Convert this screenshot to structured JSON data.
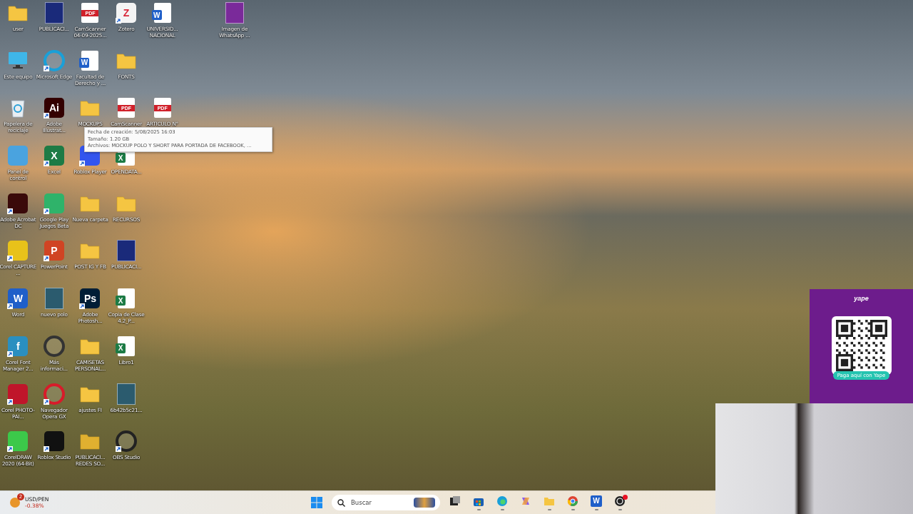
{
  "desktop": {
    "columns": [
      [
        {
          "label": "user",
          "kind": "folder",
          "color": "#f5c542",
          "shortcut": false
        },
        {
          "label": "Este equipo",
          "kind": "pc",
          "color": "#3fb6e8",
          "shortcut": false
        },
        {
          "label": "Papelera de reciclaje",
          "kind": "recycle",
          "color": "#e9eef2",
          "shortcut": false
        },
        {
          "label": "Panel de control",
          "kind": "tile",
          "color": "#4aa3df",
          "shortcut": false
        },
        {
          "label": "Adobe Acrobat DC",
          "kind": "tile",
          "color": "#3a0a0a",
          "shortcut": true
        },
        {
          "label": "Corel CAPTURE ...",
          "kind": "tile",
          "color": "#e8c21a",
          "shortcut": true
        },
        {
          "label": "Word",
          "kind": "tile",
          "color": "#1f5fc9",
          "glyph": "W",
          "shortcut": true
        },
        {
          "label": "Corel Font Manager 2...",
          "kind": "tile",
          "color": "#2a8fc0",
          "glyph": "f",
          "shortcut": true
        },
        {
          "label": "Corel PHOTO-PAI...",
          "kind": "tile",
          "color": "#c0152a",
          "shortcut": true
        },
        {
          "label": "CorelDRAW 2020 (64-Bit)",
          "kind": "tile",
          "color": "#3cc84a",
          "shortcut": true
        }
      ],
      [
        {
          "label": "PUBLICACI...",
          "kind": "image",
          "color": "#1a2a7a",
          "shortcut": false
        },
        {
          "label": "Microsoft Edge",
          "kind": "circle",
          "color": "#1aa0d8",
          "shortcut": true
        },
        {
          "label": "Adobe Illustrat...",
          "kind": "tile",
          "color": "#330000",
          "glyph": "Ai",
          "shortcut": true
        },
        {
          "label": "Excel",
          "kind": "tile",
          "color": "#1d7b45",
          "glyph": "X",
          "shortcut": true
        },
        {
          "label": "Google Play Juegos Beta",
          "kind": "tile",
          "color": "#2fb36a",
          "shortcut": true
        },
        {
          "label": "PowerPoint",
          "kind": "tile",
          "color": "#d04423",
          "glyph": "P",
          "shortcut": true
        },
        {
          "label": "nuevo polo",
          "kind": "image",
          "color": "#2b5b6e",
          "shortcut": false
        },
        {
          "label": "Más informaci...",
          "kind": "circle",
          "color": "#333333",
          "shortcut": false
        },
        {
          "label": "Navegador Opera GX",
          "kind": "circle",
          "color": "#d81b2a",
          "shortcut": true
        },
        {
          "label": "Roblox Studio",
          "kind": "tile",
          "color": "#111111",
          "shortcut": true
        }
      ],
      [
        {
          "label": "CamScanner 04-09-2025...",
          "kind": "pdf",
          "glyph": "PDF",
          "shortcut": false
        },
        {
          "label": "Facultad de Derecho y ...",
          "kind": "doc",
          "color": "#1f5fc9",
          "glyph": "W",
          "shortcut": false
        },
        {
          "label": "MOCKUPS",
          "kind": "folder",
          "color": "#f5c542",
          "shortcut": false
        },
        {
          "label": "Roblox Player",
          "kind": "tile",
          "color": "#3355ee",
          "shortcut": true
        },
        {
          "label": "Nueva carpeta",
          "kind": "folder",
          "color": "#f5c542",
          "shortcut": false
        },
        {
          "label": "POST IG Y FB",
          "kind": "folder",
          "color": "#f5c542",
          "shortcut": false
        },
        {
          "label": "Adobe Photosh...",
          "kind": "tile",
          "color": "#001e36",
          "glyph": "Ps",
          "shortcut": true
        },
        {
          "label": "CAMISETAS PERSONAL...",
          "kind": "folder",
          "color": "#f5c542",
          "shortcut": false
        },
        {
          "label": "ajustes FI",
          "kind": "folder",
          "color": "#f5c542",
          "shortcut": false
        },
        {
          "label": "PUBLICACI... REDES SO...",
          "kind": "folder",
          "color": "#e0b030",
          "shortcut": false
        }
      ],
      [
        {
          "label": "Zotero",
          "kind": "tile",
          "color": "#f4f4f4",
          "glyph": "Z",
          "shortcut": true
        },
        {
          "label": "FONTS",
          "kind": "folder",
          "color": "#f5c542",
          "shortcut": false
        },
        {
          "label": "CamScanner",
          "kind": "pdf",
          "glyph": "PDF",
          "shortcut": false
        },
        {
          "label": "OPENDATA...",
          "kind": "doc",
          "color": "#1d7b45",
          "glyph": "X",
          "shortcut": false
        },
        {
          "label": "RECURSOS",
          "kind": "folder",
          "color": "#f5c542",
          "shortcut": false
        },
        {
          "label": "PUBLICACI...",
          "kind": "image",
          "color": "#1a2a7a",
          "shortcut": false
        },
        {
          "label": "Copia de Clase 4.2_P...",
          "kind": "doc",
          "color": "#1d7b45",
          "glyph": "X",
          "shortcut": false
        },
        {
          "label": "Libro1",
          "kind": "doc",
          "color": "#1d7b45",
          "glyph": "X",
          "shortcut": false
        },
        {
          "label": "6b42b5c21...",
          "kind": "image",
          "color": "#2b5b6e",
          "shortcut": false
        },
        {
          "label": "OBS Studio",
          "kind": "circle",
          "color": "#222222",
          "shortcut": true
        }
      ],
      [
        {
          "label": "UNIVERSID... NACIONAL",
          "kind": "doc",
          "color": "#1f5fc9",
          "glyph": "W",
          "shortcut": false
        },
        null,
        {
          "label": "ARTICULO N°",
          "kind": "pdf",
          "glyph": "PDF",
          "shortcut": false
        }
      ],
      [
        null
      ],
      [
        {
          "label": "Imagen de WhatsApp ...",
          "kind": "image",
          "color": "#7a2a9a",
          "shortcut": false
        }
      ]
    ]
  },
  "tooltip": {
    "lines": [
      "Fecha de creación: 5/08/2025 16:03",
      "Tamaño: 1.20 GB",
      "Archivos: MOCKUP POLO Y SHORT PARA  PORTADA DE FACEBOOK, ..."
    ]
  },
  "qr_panel": {
    "logo": "yape",
    "button": "Paga aquí con Yape"
  },
  "taskbar": {
    "widget": {
      "badge": "2",
      "title": "USD/PEN",
      "change": "-0.38%"
    },
    "search": {
      "placeholder": "Buscar"
    },
    "apps": [
      {
        "kind": "taskview",
        "running": false,
        "alert": false
      },
      {
        "kind": "store",
        "running": true,
        "alert": false
      },
      {
        "kind": "edge",
        "running": true,
        "alert": false
      },
      {
        "kind": "copilot",
        "running": false,
        "alert": false
      },
      {
        "kind": "explorer",
        "running": true,
        "alert": false
      },
      {
        "kind": "chrome",
        "running": true,
        "alert": false
      },
      {
        "kind": "word",
        "glyph": "W",
        "running": true,
        "alert": false
      },
      {
        "kind": "obs",
        "running": true,
        "alert": true
      }
    ]
  }
}
